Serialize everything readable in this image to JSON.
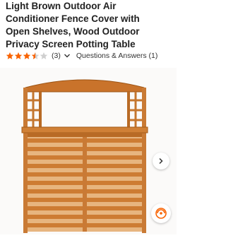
{
  "product": {
    "title_lines": [
      "Light Brown Outdoor Air",
      "Conditioner Fence Cover with",
      "Open Shelves, Wood Outdoor",
      "Privacy Screen Potting Table"
    ]
  },
  "rating": {
    "stars": 3.5,
    "max_stars": 5,
    "review_count": "(3)",
    "qa_label": "Questions & Answers (1)",
    "star_color": "#f96302"
  },
  "gallery": {
    "image_name": "wooden-ac-fence-cover-photo"
  },
  "icons": {
    "chevron": "chevron-down-icon",
    "next": "chevron-right-icon",
    "spin": "360-view-icon"
  }
}
